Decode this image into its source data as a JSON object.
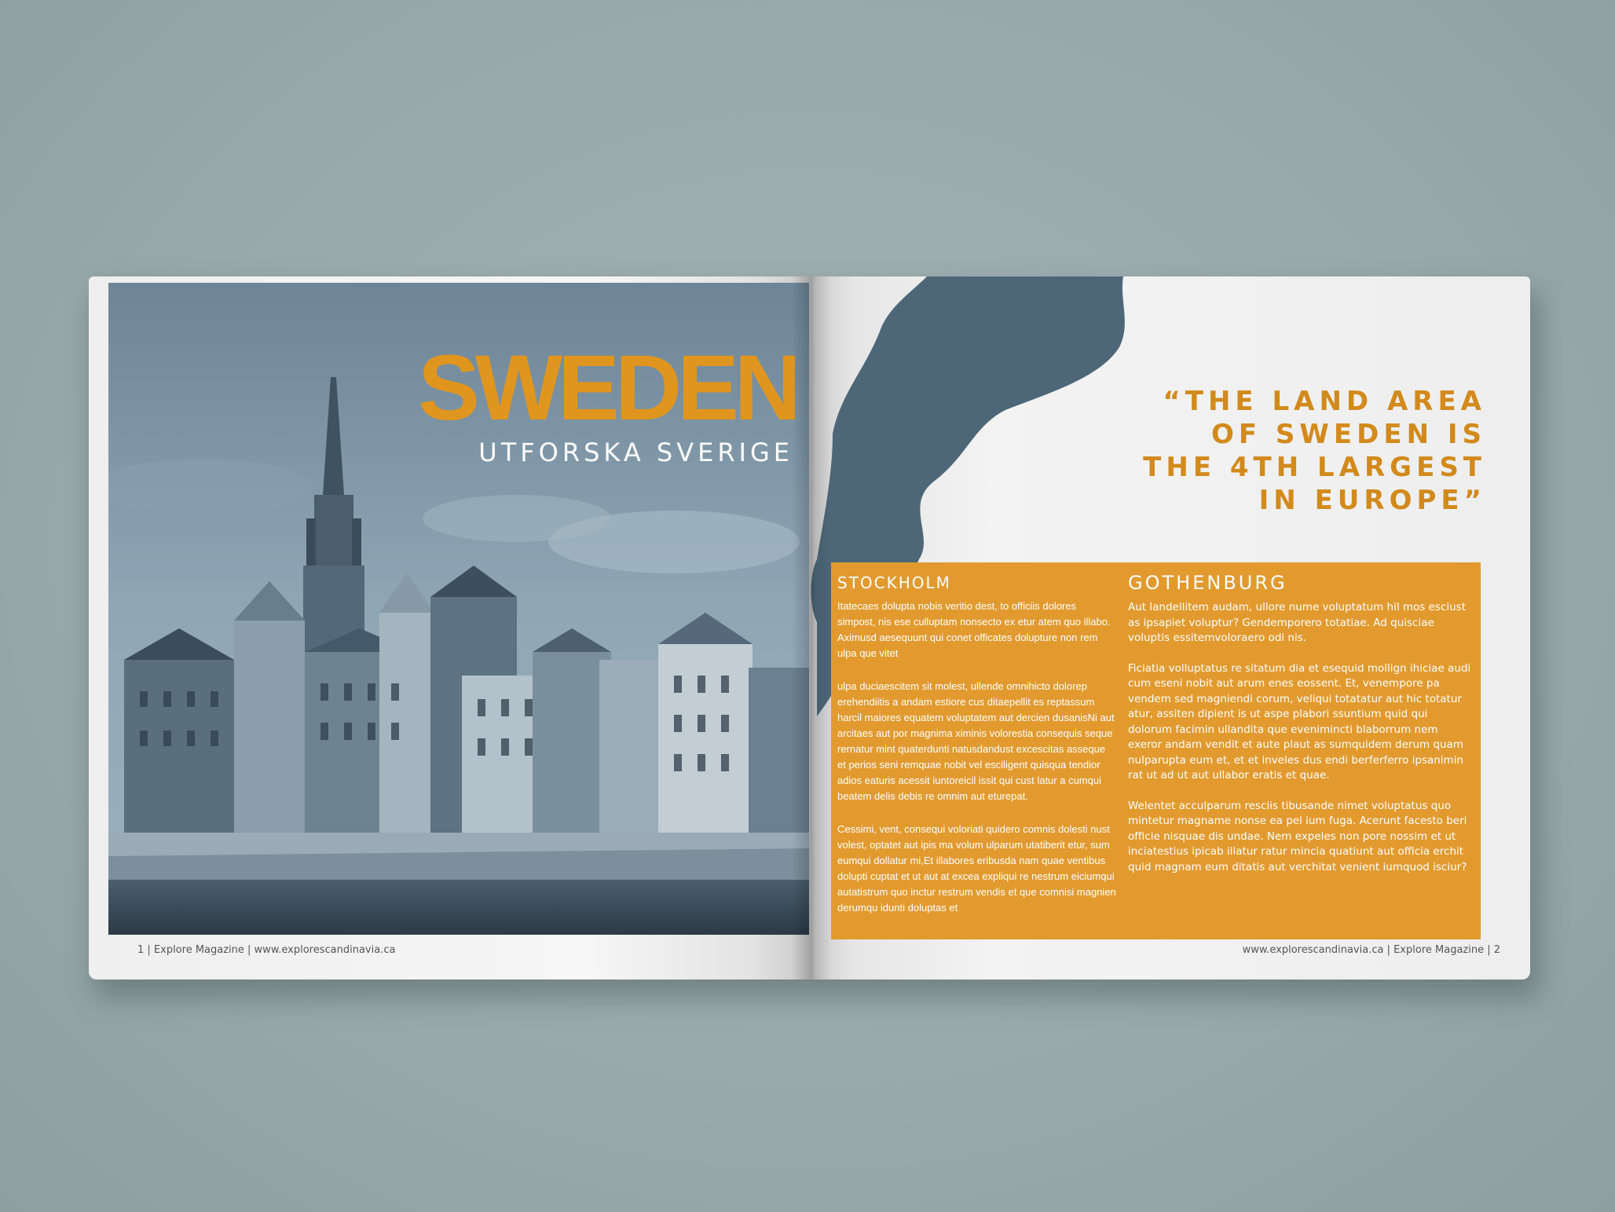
{
  "colors": {
    "background": "#9aabad",
    "accent_orange": "#e29a2f",
    "title_orange": "#e0961e",
    "map_blue": "#4d6778",
    "photo_tint": "#7e97a8"
  },
  "left_page": {
    "photo": {
      "icon": "stockholm-gamla-stan-photo"
    },
    "title": "SWEDEN",
    "subtitle": "UTFORSKA SVERIGE",
    "footer": "1 | Explore Magazine |  www.explorescandinavia.ca"
  },
  "right_page": {
    "map": {
      "icon": "sweden-map-silhouette"
    },
    "quote_lines": [
      "“THE LAND AREA",
      "OF SWEDEN IS",
      "THE 4TH LARGEST",
      "IN EUROPE”"
    ],
    "stockholm": {
      "heading": "STOCKHOLM",
      "paragraphs": [
        "Itatecaes dolupta nobis veritio dest, to officiis dolores simpost, nis ese culluptam nonsecto ex etur atem quo illabo. Aximusd aesequunt qui conet officates dolupture non rem ulpa que vitet",
        "ulpa duciaescitem sit molest, ullende omnihicto dolorep erehendiitis a andam estiore cus ditaepellit es reptassum harcil maiores equatem voluptatem aut dercien dusanisNi aut arcitaes aut por magnima ximinis volorestia consequis seque rernatur mint quaterdunti natusdandust excescitas asseque et perios seni remquae nobit vel esciligent quisqua tendior adios eaturis acessit iuntoreicil issit qui cust latur a cumqui beatem delis debis re omnim aut eturepat.",
        "Cessimi, vent, consequi voloriati quidero comnis dolesti nust volest, optatet aut ipis ma volum ulparum utatiberit etur, sum eumqui dollatur mi,Et illabores eribusda nam quae ventibus dolupti cuptat et ut aut at excea expliqui re nestrum eiciumqui autatistrum quo inctur restrum vendis et que comnisi magnien derumqu idunti doluptas et"
      ]
    },
    "gothenburg": {
      "heading": "GOTHENBURG",
      "paragraphs": [
        "Aut landellitem audam, ullore nume voluptatum hil mos esciust as ipsapiet voluptur? Gendemporero totatiae. Ad quisciae voluptis essitemvoloraero odi nis.",
        "Ficiatia volluptatus re sitatum dia et esequid mollign ihiciae audi cum eseni nobit aut arum enes eossent. Et, venempore pa vendem sed magniendi corum, veliqui totatatur aut hic totatur atur, assiten dipient is ut aspe plabori ssuntium quid qui dolorum facimin ullandita que evenimincti blaborrum nem exeror andam vendit et aute plaut as sumquidem derum quam nulparupta eum et, et et inveles dus endi berferferro ipsanimin rat ut ad ut aut ullabor eratis et quae.",
        "Welentet acculparum resciis tibusande nimet voluptatus quo mintetur magname nonse ea pel ium fuga. Acerunt facesto beri officie nisquae dis undae. Nem expeles non pore nossim et ut inciatestius ipicab illatur ratur mincia quatiunt aut officia erchit quid magnam eum ditatis aut verchitat venient iumquod isciur?"
      ]
    },
    "footer": "www.explorescandinavia.ca | Explore Magazine |  2"
  }
}
